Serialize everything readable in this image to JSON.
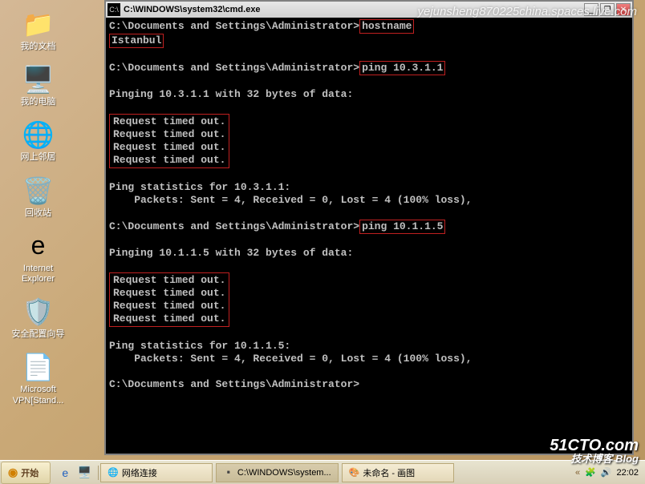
{
  "watermark_top": "yejunsheng870225china.spaces.live.com",
  "watermark_bottom": {
    "line1": "51CTO.com",
    "line2": "技术博客 Blog"
  },
  "desktop_icons": [
    {
      "label": "我的文档",
      "glyph": "📁",
      "name": "my-documents-icon"
    },
    {
      "label": "我的电脑",
      "glyph": "🖥️",
      "name": "my-computer-icon"
    },
    {
      "label": "网上邻居",
      "glyph": "🌐",
      "name": "network-places-icon"
    },
    {
      "label": "回收站",
      "glyph": "🗑️",
      "name": "recycle-bin-icon"
    },
    {
      "label": "Internet Explorer",
      "glyph": "e",
      "name": "internet-explorer-icon"
    },
    {
      "label": "安全配置向导",
      "glyph": "🛡️",
      "name": "security-wizard-icon"
    },
    {
      "label": "Microsoft VPN[Stand...",
      "glyph": "📄",
      "name": "vpn-shortcut-icon"
    }
  ],
  "cmd": {
    "title": "C:\\WINDOWS\\system32\\cmd.exe",
    "prompt": "C:\\Documents and Settings\\Administrator>",
    "cmd1": "hostname",
    "out1": "Istanbul",
    "cmd2": "ping 10.3.1.1",
    "pinging1": "Pinging 10.3.1.1 with 32 bytes of data:",
    "timeout": "Request timed out.",
    "stats1a": "Ping statistics for 10.3.1.1:",
    "stats1b": "    Packets: Sent = 4, Received = 0, Lost = 4 (100% loss),",
    "cmd3": "ping 10.1.1.5",
    "pinging2": "Pinging 10.1.1.5 with 32 bytes of data:",
    "stats2a": "Ping statistics for 10.1.1.5:",
    "stats2b": "    Packets: Sent = 4, Received = 0, Lost = 4 (100% loss),"
  },
  "taskbar": {
    "start": "开始",
    "tasks": [
      {
        "label": "网络连接",
        "name": "task-network-connections"
      },
      {
        "label": "C:\\WINDOWS\\system...",
        "name": "task-cmd"
      },
      {
        "label": "未命名 - 画图",
        "name": "task-paint"
      }
    ],
    "clock": "22:02"
  }
}
